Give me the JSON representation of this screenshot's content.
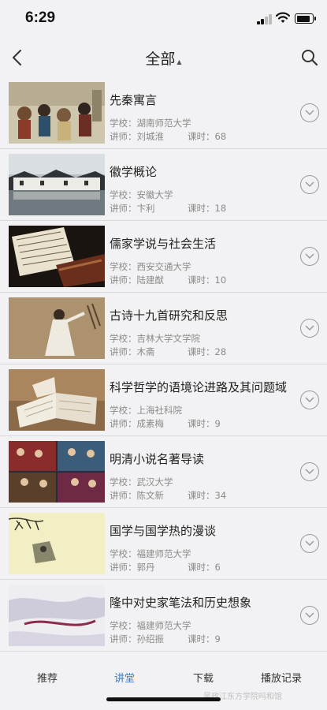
{
  "status": {
    "time": "6:29"
  },
  "nav": {
    "title": "全部",
    "caret": "▲"
  },
  "courses": [
    {
      "title": "先秦寓言",
      "school_label": "学校：",
      "school": "湖南师范大学",
      "teacher_label": "讲师：",
      "teacher": "刘城淮",
      "hours_label": "课时：",
      "hours": "68"
    },
    {
      "title": "徽学概论",
      "school_label": "学校：",
      "school": "安徽大学",
      "teacher_label": "讲师：",
      "teacher": "卞利",
      "hours_label": "课时：",
      "hours": "18"
    },
    {
      "title": "儒家学说与社会生活",
      "school_label": "学校：",
      "school": "西安交通大学",
      "teacher_label": "讲师：",
      "teacher": "陆建猷",
      "hours_label": "课时：",
      "hours": "10"
    },
    {
      "title": "古诗十九首研究和反思",
      "school_label": "学校：",
      "school": "吉林大学文学院",
      "teacher_label": "讲师：",
      "teacher": "木斋",
      "hours_label": "课时：",
      "hours": "28"
    },
    {
      "title": "科学哲学的语境论进路及其问题域",
      "school_label": "学校：",
      "school": "上海社科院",
      "teacher_label": "讲师：",
      "teacher": "成素梅",
      "hours_label": "课时：",
      "hours": "9"
    },
    {
      "title": "明清小说名著导读",
      "school_label": "学校：",
      "school": "武汉大学",
      "teacher_label": "讲师：",
      "teacher": "陈文新",
      "hours_label": "课时：",
      "hours": "34"
    },
    {
      "title": "国学与国学热的漫谈",
      "school_label": "学校：",
      "school": "福建师范大学",
      "teacher_label": "讲师：",
      "teacher": "郭丹",
      "hours_label": "课时：",
      "hours": "6"
    },
    {
      "title": "隆中对史家笔法和历史想象",
      "school_label": "学校：",
      "school": "福建师范大学",
      "teacher_label": "讲师：",
      "teacher": "孙绍振",
      "hours_label": "课时：",
      "hours": "9"
    }
  ],
  "tabs": [
    "推荐",
    "讲堂",
    "下载",
    "播放记录"
  ],
  "watermark": "吴政江东方学院吗和馆",
  "colors": {
    "accent": "#2d7dd2",
    "background": "#f2f2f4",
    "meta_text": "#8a8a8a"
  }
}
